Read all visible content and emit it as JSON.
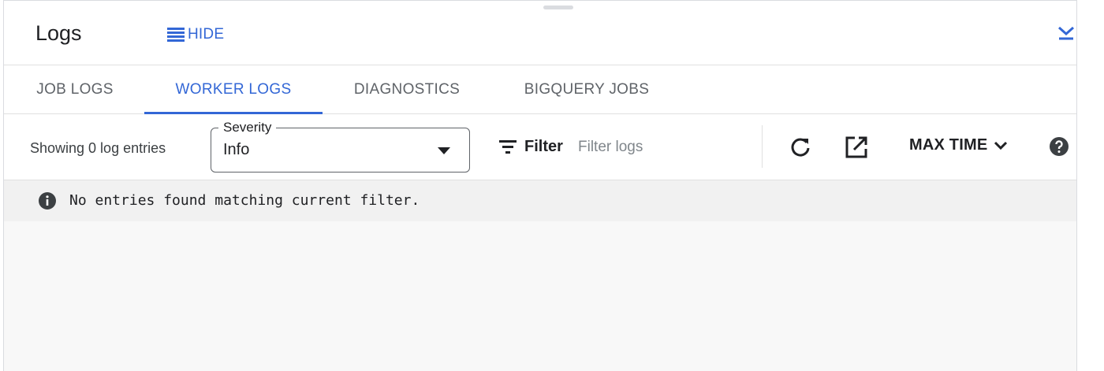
{
  "header": {
    "title": "Logs",
    "hide_label": "HIDE"
  },
  "tabs": [
    {
      "label": "JOB LOGS",
      "active": false
    },
    {
      "label": "WORKER LOGS",
      "active": true
    },
    {
      "label": "DIAGNOSTICS",
      "active": false
    },
    {
      "label": "BIGQUERY JOBS",
      "active": false
    }
  ],
  "toolbar": {
    "showing_text": "Showing 0 log entries",
    "severity": {
      "label": "Severity",
      "value": "Info"
    },
    "filter_label": "Filter",
    "filter_placeholder": "Filter logs",
    "max_time_label": "MAX TIME"
  },
  "message": {
    "text": "No entries found matching current filter."
  },
  "colors": {
    "accent": "#3367d6",
    "message_bg": "#f1f1f1",
    "log_area_bg": "#f8f8f8"
  },
  "icons": {
    "hide": "menu-lines-icon",
    "collapse": "chevron-down-icon",
    "filter": "filter-icon",
    "refresh": "refresh-icon",
    "open": "open-in-new-icon",
    "help": "help-icon",
    "info": "info-icon"
  }
}
